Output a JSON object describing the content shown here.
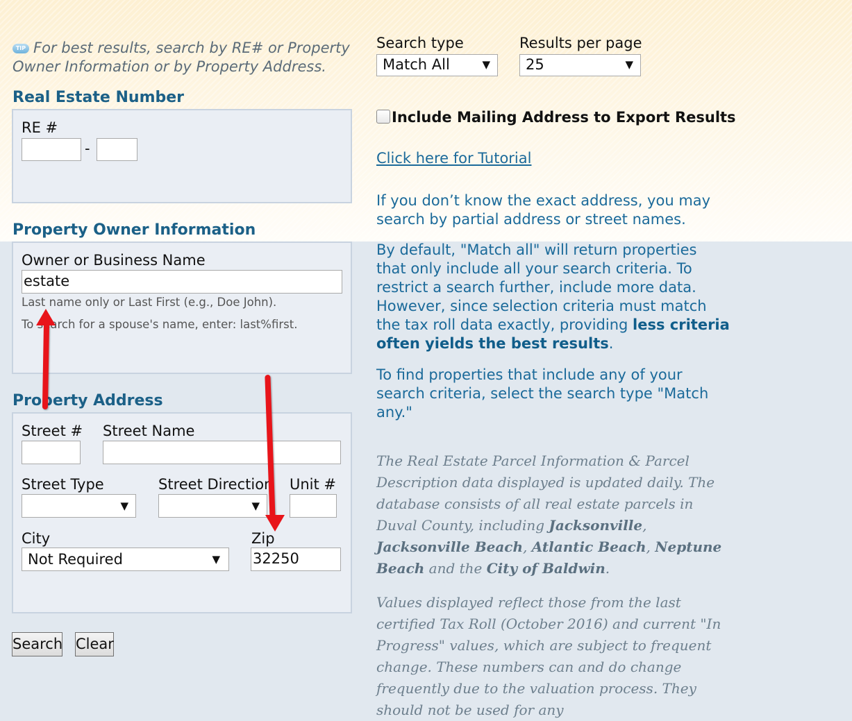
{
  "tip": {
    "icon": "tip-icon",
    "icon_text": "TIP",
    "text": "For best results, search by RE# or Property Owner Information or by Property Address."
  },
  "search_type": {
    "label": "Search type",
    "value": "Match All"
  },
  "results_per_page": {
    "label": "Results per page",
    "value": "25"
  },
  "real_estate": {
    "title": "Real Estate Number",
    "re_label": "RE #",
    "dash": "-",
    "re_part1": "",
    "re_part2": ""
  },
  "mailing": {
    "label": "Include Mailing Address to Export Results",
    "checked": false
  },
  "tutorial": {
    "link": "Click here for Tutorial"
  },
  "info": {
    "p1": "If you don’t know the exact address, you may search by partial address or street names.",
    "p2_a": "By default, \"Match all\" will return properties that only include all your search criteria. To restrict a search further, include more data. However, since selection criteria must match the tax roll data exactly, providing ",
    "p2_b": "less criteria often yields the best results",
    "p2_c": ".",
    "p3": "To find properties that include any of your search criteria, select the search type \"Match any.\""
  },
  "owner": {
    "title": "Property Owner Information",
    "name_label": "Owner or Business Name",
    "name_value": "estate",
    "hint1": "Last name only or Last First (e.g., Doe John).",
    "hint2": "To search for a spouse's name, enter: last%first."
  },
  "address": {
    "title": "Property Address",
    "street_num_label": "Street #",
    "street_num_value": "",
    "street_name_label": "Street Name",
    "street_name_value": "",
    "street_type_label": "Street Type",
    "street_type_value": "",
    "street_dir_label": "Street Direction",
    "street_dir_value": "",
    "unit_label": "Unit #",
    "unit_value": "",
    "city_label": "City",
    "city_value": "Not Required",
    "zip_label": "Zip",
    "zip_value": "32250"
  },
  "buttons": {
    "search": "Search",
    "clear": "Clear"
  },
  "note1": {
    "a": "The Real Estate Parcel Information & Parcel Description data displayed is updated daily. The database consists of all real estate parcels in Duval County, including ",
    "b1": "Jacksonville",
    "sep1": ", ",
    "b2": "Jacksonville Beach",
    "sep2": ", ",
    "b3": "Atlantic Beach",
    "sep3": ", ",
    "b4": "Neptune Beach",
    "sep4": " and the ",
    "b5": "City of Baldwin",
    "end": "."
  },
  "note2": "Values displayed reflect those from the last certified Tax Roll (October 2016) and current \"In Progress\" values, which are subject to frequent change. These numbers can and do change frequently due to the valuation process. They should not be used for any",
  "colors": {
    "accent": "#1b6087",
    "annotation_arrow": "#e8141a"
  }
}
